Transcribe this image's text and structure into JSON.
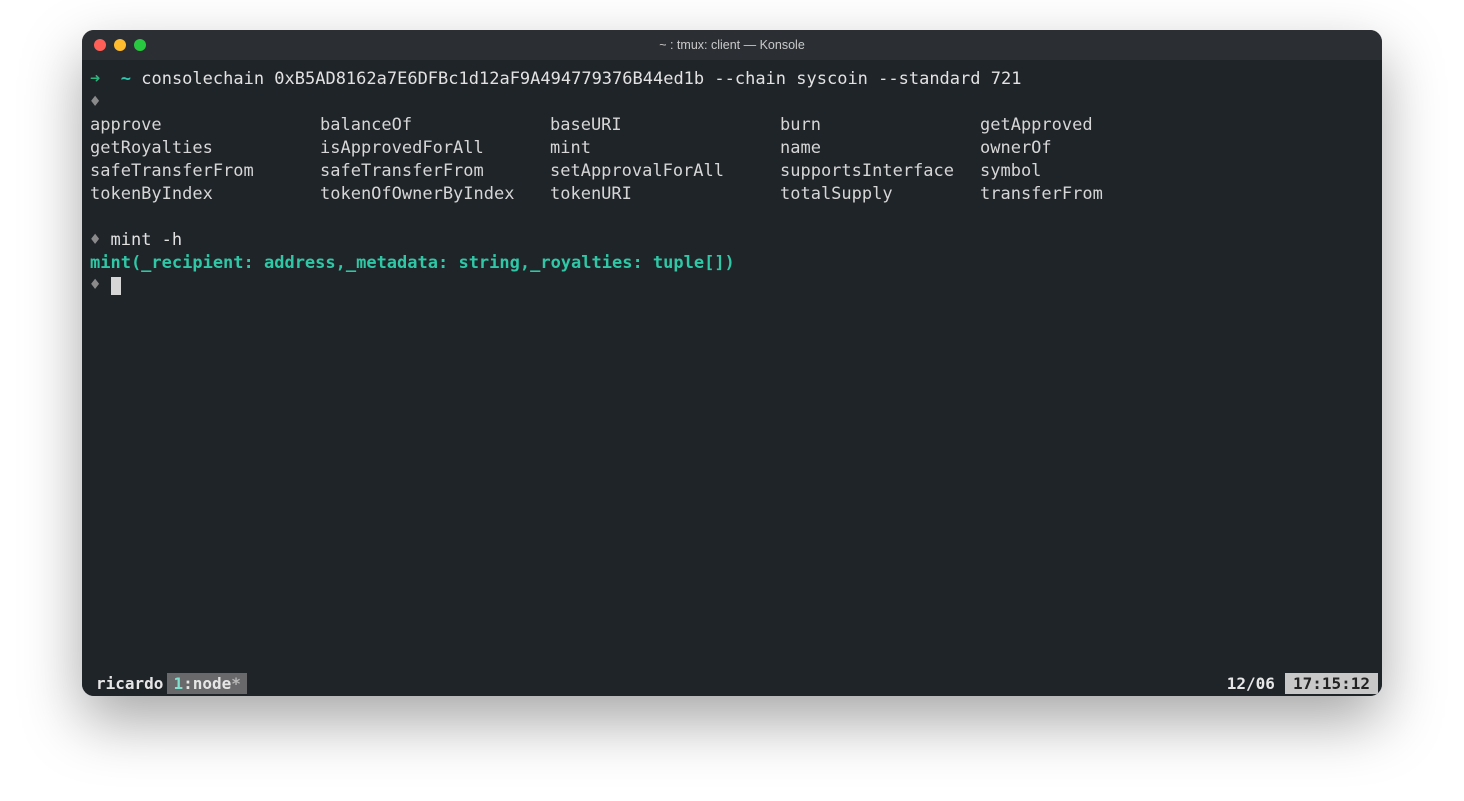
{
  "window": {
    "title": "~ : tmux: client — Konsole"
  },
  "prompt": {
    "arrow": "➜",
    "tilde": "~",
    "diamond": "♦"
  },
  "cmd1": "consolechain 0xB5AD8162a7E6DFBc1d12aF9A494779376B44ed1b --chain syscoin --standard 721",
  "completions": [
    [
      "approve",
      "balanceOf",
      "baseURI",
      "burn",
      "getApproved"
    ],
    [
      "getRoyalties",
      "isApprovedForAll",
      "mint",
      "name",
      "ownerOf"
    ],
    [
      "safeTransferFrom",
      "safeTransferFrom",
      "setApprovalForAll",
      "supportsInterface",
      "symbol"
    ],
    [
      "tokenByIndex",
      "tokenOfOwnerByIndex",
      "tokenURI",
      "totalSupply",
      "transferFrom"
    ]
  ],
  "cmd2": "mint -h",
  "help_line": "mint(_recipient: address,_metadata: string,_royalties: tuple[])",
  "status": {
    "session": "ricardo",
    "tab_index": "1",
    "tab_sep": ":",
    "tab_name": "node",
    "tab_mark": "*",
    "date": "12/06",
    "time": "17:15:12"
  }
}
